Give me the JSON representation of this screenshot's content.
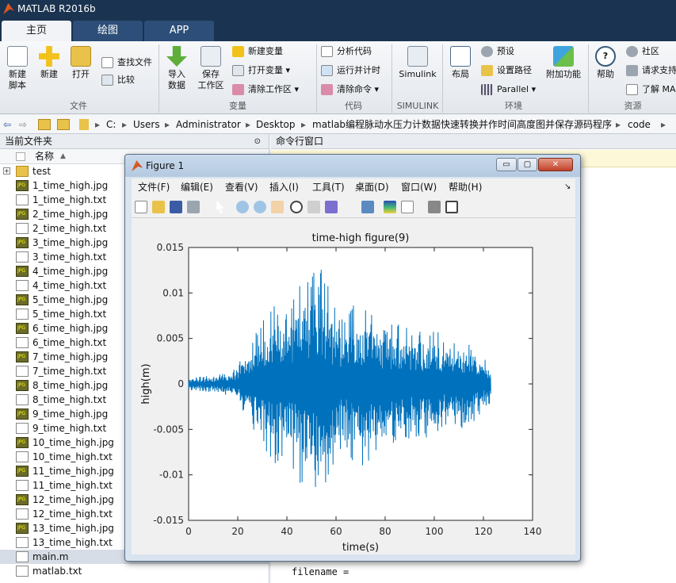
{
  "app": {
    "title": "MATLAB R2016b"
  },
  "tabs": [
    {
      "label": "主页"
    },
    {
      "label": "绘图"
    },
    {
      "label": "APP"
    }
  ],
  "ribbon": {
    "file": {
      "new_script": "新建\n脚本",
      "new": "新建",
      "open": "打开",
      "find_files": "查找文件",
      "compare": "比较",
      "group": "文件"
    },
    "variable": {
      "import": "导入\n数据",
      "save": "保存\n工作区",
      "new_var": "新建变量",
      "open_var": "打开变量",
      "clear_ws": "清除工作区",
      "group": "变量"
    },
    "code": {
      "analyze": "分析代码",
      "run_time": "运行并计时",
      "clear_cmd": "清除命令",
      "group": "代码"
    },
    "simulink": {
      "label": "Simulink",
      "group": "SIMULINK"
    },
    "env": {
      "layout": "布局",
      "prefs": "预设",
      "set_path": "设置路径",
      "parallel": "Parallel",
      "addons": "附加功能",
      "group": "环境"
    },
    "resources": {
      "help": "帮助",
      "community": "社区",
      "support": "请求支持",
      "learn": "了解 MA",
      "group": "资源"
    }
  },
  "address": {
    "crumbs": [
      "C:",
      "Users",
      "Administrator",
      "Desktop",
      "matlab编程脉动水压力计数据快速转换并作时间高度图并保存源码程序",
      "code"
    ]
  },
  "file_panel": {
    "title": "当前文件夹",
    "col_name": "名称",
    "items": [
      {
        "name": "test",
        "type": "folder"
      },
      {
        "name": "1_time_high.jpg",
        "type": "jpg"
      },
      {
        "name": "1_time_high.txt",
        "type": "txt"
      },
      {
        "name": "2_time_high.jpg",
        "type": "jpg"
      },
      {
        "name": "2_time_high.txt",
        "type": "txt"
      },
      {
        "name": "3_time_high.jpg",
        "type": "jpg"
      },
      {
        "name": "3_time_high.txt",
        "type": "txt"
      },
      {
        "name": "4_time_high.jpg",
        "type": "jpg"
      },
      {
        "name": "4_time_high.txt",
        "type": "txt"
      },
      {
        "name": "5_time_high.jpg",
        "type": "jpg"
      },
      {
        "name": "5_time_high.txt",
        "type": "txt"
      },
      {
        "name": "6_time_high.jpg",
        "type": "jpg"
      },
      {
        "name": "6_time_high.txt",
        "type": "txt"
      },
      {
        "name": "7_time_high.jpg",
        "type": "jpg"
      },
      {
        "name": "7_time_high.txt",
        "type": "txt"
      },
      {
        "name": "8_time_high.jpg",
        "type": "jpg"
      },
      {
        "name": "8_time_high.txt",
        "type": "txt"
      },
      {
        "name": "9_time_high.jpg",
        "type": "jpg"
      },
      {
        "name": "9_time_high.txt",
        "type": "txt"
      },
      {
        "name": "10_time_high.jpg",
        "type": "jpg"
      },
      {
        "name": "10_time_high.txt",
        "type": "txt"
      },
      {
        "name": "11_time_high.jpg",
        "type": "jpg"
      },
      {
        "name": "11_time_high.txt",
        "type": "txt"
      },
      {
        "name": "12_time_high.jpg",
        "type": "jpg"
      },
      {
        "name": "12_time_high.txt",
        "type": "txt"
      },
      {
        "name": "13_time_high.jpg",
        "type": "jpg"
      },
      {
        "name": "13_time_high.txt",
        "type": "txt"
      },
      {
        "name": "main.m",
        "type": "m"
      },
      {
        "name": "matlab.txt",
        "type": "txt"
      }
    ]
  },
  "cmd_panel": {
    "title": "命令行窗口",
    "line": "filename ="
  },
  "figure": {
    "title": "Figure 1",
    "menu": [
      "文件(F)",
      "编辑(E)",
      "查看(V)",
      "插入(I)",
      "工具(T)",
      "桌面(D)",
      "窗口(W)",
      "帮助(H)"
    ]
  },
  "chart_data": {
    "type": "line",
    "title": "time-high figure(9)",
    "xlabel": "time(s)",
    "ylabel": "high(m)",
    "xlim": [
      0,
      140
    ],
    "ylim": [
      -0.015,
      0.015
    ],
    "xticks": [
      "0",
      "20",
      "40",
      "60",
      "80",
      "100",
      "120",
      "140"
    ],
    "yticks": [
      "0.015",
      "0.01",
      "0.005",
      "0",
      "-0.005",
      "-0.01",
      "-0.015"
    ],
    "color": "#0072bd",
    "series": [
      {
        "x_start": 0,
        "x_end": 123,
        "envelope": [
          [
            0,
            0.0007
          ],
          [
            10,
            0.0009
          ],
          [
            18,
            0.0014
          ],
          [
            22,
            0.003
          ],
          [
            28,
            0.006
          ],
          [
            32,
            0.008
          ],
          [
            36,
            0.009
          ],
          [
            40,
            0.008
          ],
          [
            45,
            0.011
          ],
          [
            50,
            0.012
          ],
          [
            53,
            0.014
          ],
          [
            58,
            0.01
          ],
          [
            63,
            0.007
          ],
          [
            68,
            0.009
          ],
          [
            72,
            0.009
          ],
          [
            76,
            0.008
          ],
          [
            80,
            0.006
          ],
          [
            85,
            0.007
          ],
          [
            90,
            0.006
          ],
          [
            95,
            0.006
          ],
          [
            100,
            0.006
          ],
          [
            105,
            0.005
          ],
          [
            110,
            0.005
          ],
          [
            118,
            0.004
          ],
          [
            123,
            0.002
          ]
        ]
      }
    ]
  }
}
